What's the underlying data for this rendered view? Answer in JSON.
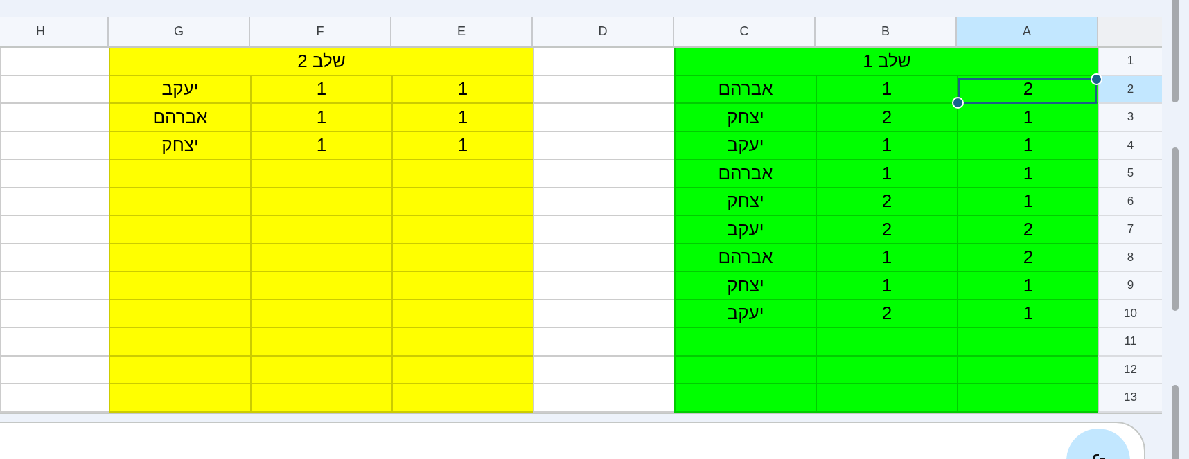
{
  "columns": [
    {
      "label": "A",
      "selected": true
    },
    {
      "label": "B",
      "selected": false
    },
    {
      "label": "C",
      "selected": false
    },
    {
      "label": "D",
      "selected": false
    },
    {
      "label": "E",
      "selected": false
    },
    {
      "label": "F",
      "selected": false
    },
    {
      "label": "G",
      "selected": false
    },
    {
      "label": "H",
      "selected": false
    }
  ],
  "rows": [
    {
      "label": "1",
      "selected": false,
      "cells": [
        {
          "kind": "cell",
          "text": "שלב 1",
          "color": "#00ff00"
        },
        {
          "kind": "joined"
        },
        {
          "kind": "joined"
        },
        {
          "kind": "cell"
        },
        {
          "kind": "cell",
          "text": "שלב 2",
          "color": "#ffff00"
        },
        {
          "kind": "joined"
        },
        {
          "kind": "joined"
        },
        {
          "kind": "cell"
        }
      ]
    },
    {
      "label": "2",
      "selected": true,
      "cells": [
        {
          "kind": "cell",
          "text": "2",
          "color": "#00ff00"
        },
        {
          "kind": "cell",
          "text": "1",
          "color": "#00ff00"
        },
        {
          "kind": "cell",
          "text": "אברהם",
          "color": "#00ff00"
        },
        {
          "kind": "cell"
        },
        {
          "kind": "cell",
          "text": "1",
          "color": "#ffff00"
        },
        {
          "kind": "cell",
          "text": "1",
          "color": "#ffff00"
        },
        {
          "kind": "cell",
          "text": "יעקב",
          "color": "#ffff00"
        },
        {
          "kind": "cell"
        }
      ]
    },
    {
      "label": "3",
      "selected": false,
      "cells": [
        {
          "kind": "cell",
          "text": "1",
          "color": "#00ff00"
        },
        {
          "kind": "cell",
          "text": "2",
          "color": "#00ff00"
        },
        {
          "kind": "cell",
          "text": "יצחק",
          "color": "#00ff00"
        },
        {
          "kind": "cell"
        },
        {
          "kind": "cell",
          "text": "1",
          "color": "#ffff00"
        },
        {
          "kind": "cell",
          "text": "1",
          "color": "#ffff00"
        },
        {
          "kind": "cell",
          "text": "אברהם",
          "color": "#ffff00"
        },
        {
          "kind": "cell"
        }
      ]
    },
    {
      "label": "4",
      "selected": false,
      "cells": [
        {
          "kind": "cell",
          "text": "1",
          "color": "#00ff00"
        },
        {
          "kind": "cell",
          "text": "1",
          "color": "#00ff00"
        },
        {
          "kind": "cell",
          "text": "יעקב",
          "color": "#00ff00"
        },
        {
          "kind": "cell"
        },
        {
          "kind": "cell",
          "text": "1",
          "color": "#ffff00"
        },
        {
          "kind": "cell",
          "text": "1",
          "color": "#ffff00"
        },
        {
          "kind": "cell",
          "text": "יצחק",
          "color": "#ffff00"
        },
        {
          "kind": "cell"
        }
      ]
    },
    {
      "label": "5",
      "selected": false,
      "cells": [
        {
          "kind": "cell",
          "text": "1",
          "color": "#00ff00"
        },
        {
          "kind": "cell",
          "text": "1",
          "color": "#00ff00"
        },
        {
          "kind": "cell",
          "text": "אברהם",
          "color": "#00ff00"
        },
        {
          "kind": "cell"
        },
        {
          "kind": "cell",
          "color": "#ffff00"
        },
        {
          "kind": "cell",
          "color": "#ffff00"
        },
        {
          "kind": "cell",
          "color": "#ffff00"
        },
        {
          "kind": "cell"
        }
      ]
    },
    {
      "label": "6",
      "selected": false,
      "cells": [
        {
          "kind": "cell",
          "text": "1",
          "color": "#00ff00"
        },
        {
          "kind": "cell",
          "text": "2",
          "color": "#00ff00"
        },
        {
          "kind": "cell",
          "text": "יצחק",
          "color": "#00ff00"
        },
        {
          "kind": "cell"
        },
        {
          "kind": "cell",
          "color": "#ffff00"
        },
        {
          "kind": "cell",
          "color": "#ffff00"
        },
        {
          "kind": "cell",
          "color": "#ffff00"
        },
        {
          "kind": "cell"
        }
      ]
    },
    {
      "label": "7",
      "selected": false,
      "cells": [
        {
          "kind": "cell",
          "text": "2",
          "color": "#00ff00"
        },
        {
          "kind": "cell",
          "text": "2",
          "color": "#00ff00"
        },
        {
          "kind": "cell",
          "text": "יעקב",
          "color": "#00ff00"
        },
        {
          "kind": "cell"
        },
        {
          "kind": "cell",
          "color": "#ffff00"
        },
        {
          "kind": "cell",
          "color": "#ffff00"
        },
        {
          "kind": "cell",
          "color": "#ffff00"
        },
        {
          "kind": "cell"
        }
      ]
    },
    {
      "label": "8",
      "selected": false,
      "cells": [
        {
          "kind": "cell",
          "text": "2",
          "color": "#00ff00"
        },
        {
          "kind": "cell",
          "text": "1",
          "color": "#00ff00"
        },
        {
          "kind": "cell",
          "text": "אברהם",
          "color": "#00ff00"
        },
        {
          "kind": "cell"
        },
        {
          "kind": "cell",
          "color": "#ffff00"
        },
        {
          "kind": "cell",
          "color": "#ffff00"
        },
        {
          "kind": "cell",
          "color": "#ffff00"
        },
        {
          "kind": "cell"
        }
      ]
    },
    {
      "label": "9",
      "selected": false,
      "cells": [
        {
          "kind": "cell",
          "text": "1",
          "color": "#00ff00"
        },
        {
          "kind": "cell",
          "text": "1",
          "color": "#00ff00"
        },
        {
          "kind": "cell",
          "text": "יצחק",
          "color": "#00ff00"
        },
        {
          "kind": "cell"
        },
        {
          "kind": "cell",
          "color": "#ffff00"
        },
        {
          "kind": "cell",
          "color": "#ffff00"
        },
        {
          "kind": "cell",
          "color": "#ffff00"
        },
        {
          "kind": "cell"
        }
      ]
    },
    {
      "label": "10",
      "selected": false,
      "cells": [
        {
          "kind": "cell",
          "text": "1",
          "color": "#00ff00"
        },
        {
          "kind": "cell",
          "text": "2",
          "color": "#00ff00"
        },
        {
          "kind": "cell",
          "text": "יעקב",
          "color": "#00ff00"
        },
        {
          "kind": "cell"
        },
        {
          "kind": "cell",
          "color": "#ffff00"
        },
        {
          "kind": "cell",
          "color": "#ffff00"
        },
        {
          "kind": "cell",
          "color": "#ffff00"
        },
        {
          "kind": "cell"
        }
      ]
    },
    {
      "label": "11",
      "selected": false,
      "cells": [
        {
          "kind": "cell",
          "color": "#00ff00"
        },
        {
          "kind": "cell",
          "color": "#00ff00"
        },
        {
          "kind": "cell",
          "color": "#00ff00"
        },
        {
          "kind": "cell"
        },
        {
          "kind": "cell",
          "color": "#ffff00"
        },
        {
          "kind": "cell",
          "color": "#ffff00"
        },
        {
          "kind": "cell",
          "color": "#ffff00"
        },
        {
          "kind": "cell"
        }
      ]
    },
    {
      "label": "12",
      "selected": false,
      "cells": [
        {
          "kind": "cell",
          "color": "#00ff00"
        },
        {
          "kind": "cell",
          "color": "#00ff00"
        },
        {
          "kind": "cell",
          "color": "#00ff00"
        },
        {
          "kind": "cell"
        },
        {
          "kind": "cell",
          "color": "#ffff00"
        },
        {
          "kind": "cell",
          "color": "#ffff00"
        },
        {
          "kind": "cell",
          "color": "#ffff00"
        },
        {
          "kind": "cell"
        }
      ]
    },
    {
      "label": "13",
      "selected": false,
      "cells": [
        {
          "kind": "cell",
          "color": "#00ff00"
        },
        {
          "kind": "cell",
          "color": "#00ff00"
        },
        {
          "kind": "cell",
          "color": "#00ff00"
        },
        {
          "kind": "cell"
        },
        {
          "kind": "cell",
          "color": "#ffff00"
        },
        {
          "kind": "cell",
          "color": "#ffff00"
        },
        {
          "kind": "cell",
          "color": "#ffff00"
        },
        {
          "kind": "cell"
        }
      ]
    }
  ]
}
